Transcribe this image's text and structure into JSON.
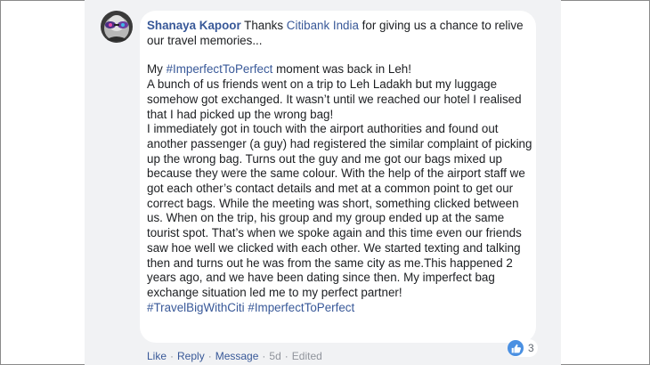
{
  "comment": {
    "author": "Shanaya Kapoor",
    "intro_before": " Thanks ",
    "mention": "Citibank India",
    "intro_after": " for giving us a chance to relive our travel memories...",
    "line1_prefix": "My ",
    "line1_hashtag": "#ImperfectToPerfect",
    "line1_suffix": " moment was back in Leh!",
    "body_text": "A bunch of us friends went on a trip to Leh Ladakh but my luggage somehow got exchanged. It wasn’t until we reached our hotel I realised that I had picked up the wrong bag!\nI immediately got in touch with the airport authorities and found out another passenger (a guy) had registered the similar complaint of picking up the wrong bag. Turns out the guy and me got our bags mixed up because they were the same colour. With the help of the airport staff we got each other’s contact details and met at a common point to get our correct bags. While the meeting was short, something clicked between us. When on the trip, his group and my group ended up at the same tourist spot. That’s when we spoke again and this time even our friends saw hoe well we clicked with each other. We started texting and talking then and turns out he was from the same city as me.This happened 2 years ago, and we have been dating since then. My imperfect bag exchange situation led me to my perfect partner!",
    "hashtag1": "#TravelBigWithCiti",
    "hashtag2": "#ImperfectToPerfect"
  },
  "reactions": {
    "icon": "like-icon",
    "count": "3",
    "color": "#4a90e2"
  },
  "actions": {
    "like": "Like",
    "reply": "Reply",
    "message": "Message",
    "time": "5d",
    "edited": "Edited",
    "separator": "·"
  },
  "colors": {
    "link": "#385898",
    "text": "#1c1e21",
    "panel": "#f1f2f4"
  }
}
